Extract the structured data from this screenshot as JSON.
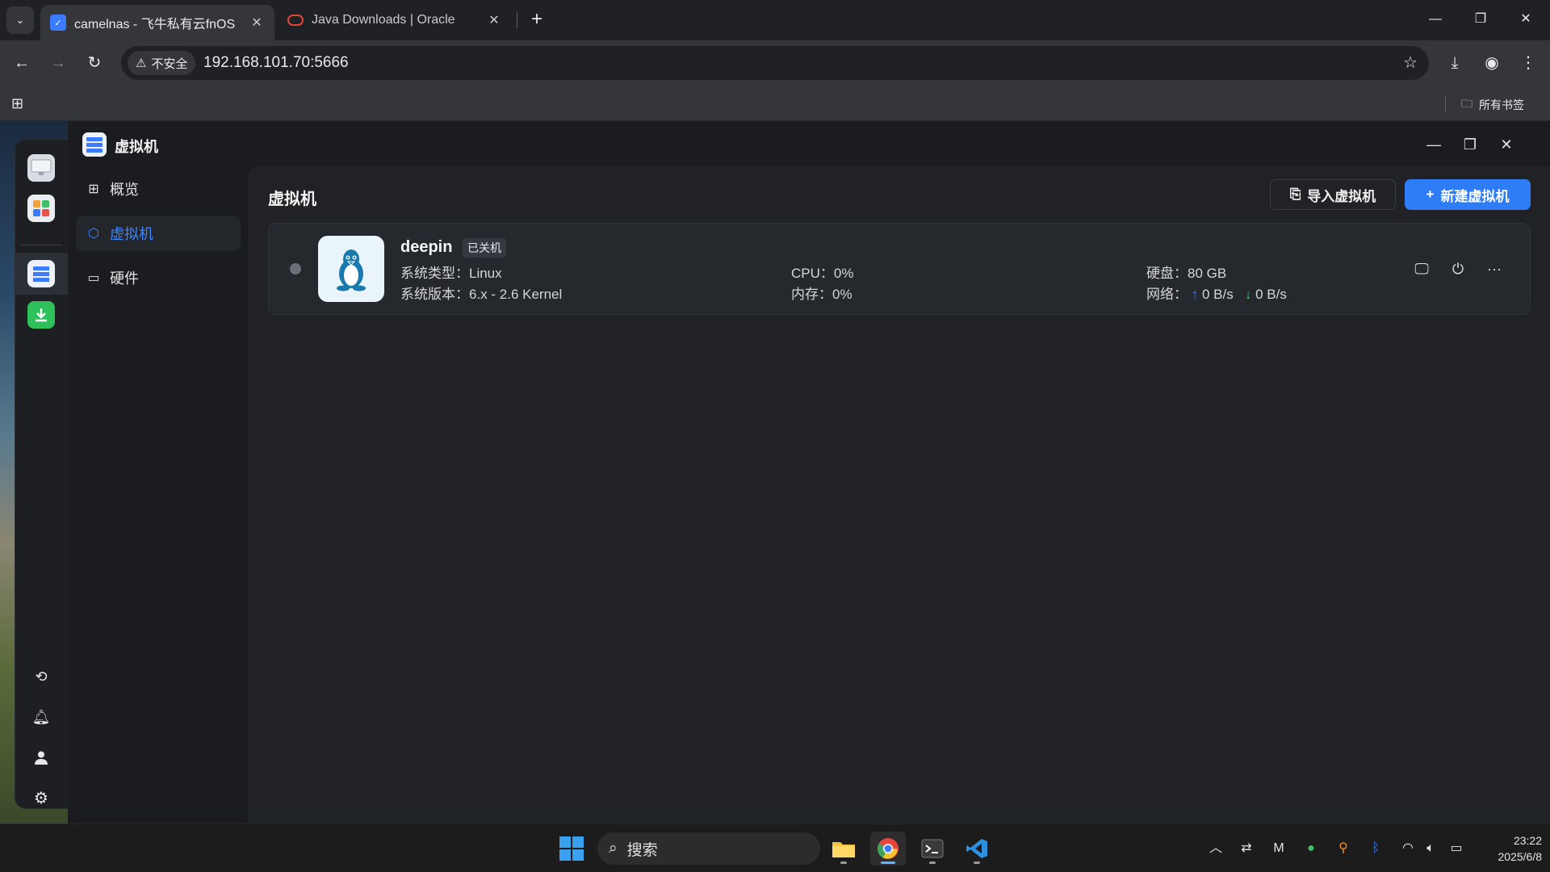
{
  "browser": {
    "tabs": [
      {
        "title": "camelnas - 飞牛私有云fnOS",
        "active": true
      },
      {
        "title": "Java Downloads | Oracle",
        "active": false
      }
    ],
    "security_label": "不安全",
    "url": "192.168.101.70:5666",
    "bookmarks_all": "所有书签"
  },
  "app": {
    "title": "虚拟机",
    "nav": [
      {
        "label": "概览",
        "icon": "grid-icon"
      },
      {
        "label": "虚拟机",
        "icon": "cube-icon",
        "active": true
      },
      {
        "label": "硬件",
        "icon": "drive-icon"
      }
    ],
    "content_title": "虚拟机",
    "import_button": "导入虚拟机",
    "new_button": "新建虚拟机",
    "vm": {
      "name": "deepin",
      "status": "已关机",
      "type_label": "系统类型：",
      "type_value": "Linux",
      "version_label": "系统版本：",
      "version_value": "6.x - 2.6 Kernel",
      "cpu_label": "CPU：",
      "cpu_value": "0%",
      "mem_label": "内存：",
      "mem_value": "0%",
      "disk_label": "硬盘：",
      "disk_value": "80 GB",
      "net_label": "网络：",
      "net_up": "0 B/s",
      "net_down": "0 B/s"
    }
  },
  "taskbar": {
    "search_placeholder": "搜索",
    "time": "23:22",
    "date": "2025/6/8"
  },
  "colors": {
    "accent": "#2f7df6",
    "nav_active": "#3f86ff",
    "status_off": "#6b7078"
  }
}
